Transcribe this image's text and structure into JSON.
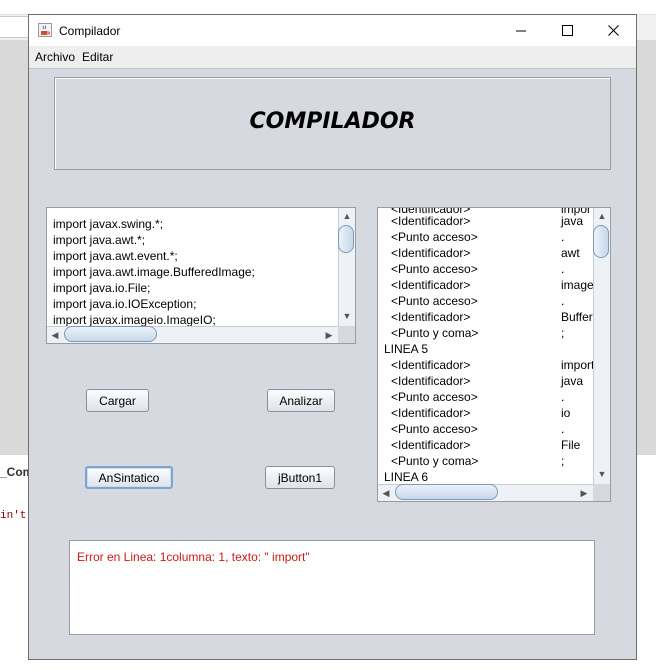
{
  "window": {
    "title": "Compilador"
  },
  "menu": [
    "Archivo",
    "Editar"
  ],
  "header": {
    "title": "COMPILADOR"
  },
  "source_editor": {
    "lines": [
      "import javax.swing.*;",
      "import java.awt.*;",
      "import java.awt.event.*;",
      "import java.awt.image.BufferedImage;",
      "import java.io.File;",
      "import java.io.IOException;",
      "import javax.imageio.ImageIO;"
    ]
  },
  "tokens": {
    "partial_top": {
      "label": "<Identificador>",
      "value": "impor"
    },
    "rows": [
      {
        "label": "<Identificador>",
        "value": "java"
      },
      {
        "label": "<Punto acceso>",
        "value": "."
      },
      {
        "label": "<Identificador>",
        "value": "awt"
      },
      {
        "label": "<Punto acceso>",
        "value": "."
      },
      {
        "label": "<Identificador>",
        "value": "image"
      },
      {
        "label": "<Punto acceso>",
        "value": "."
      },
      {
        "label": "<Identificador>",
        "value": "Buffere"
      },
      {
        "label": "<Punto y coma>",
        "value": ";"
      },
      {
        "header": "LINEA 5"
      },
      {
        "label": "<Identificador>",
        "value": "import"
      },
      {
        "label": "<Identificador>",
        "value": "java"
      },
      {
        "label": "<Punto acceso>",
        "value": "."
      },
      {
        "label": "<Identificador>",
        "value": "io"
      },
      {
        "label": "<Punto acceso>",
        "value": "."
      },
      {
        "label": "<Identificador>",
        "value": "File"
      },
      {
        "label": "<Punto y coma>",
        "value": ";"
      },
      {
        "header": "LINEA 6"
      }
    ]
  },
  "buttons": {
    "cargar": "Cargar",
    "analizar": "Analizar",
    "ansintatico": "AnSintatico",
    "jbutton1": "jButton1"
  },
  "error": {
    "text": "Error en Linea: 1columna: 1, texto: \" import\""
  },
  "background": {
    "tab_label": "_Com",
    "code_fragment": "in't"
  },
  "colors": {
    "error_text": "#cc1a1a",
    "window_bg": "#d6d9df"
  }
}
